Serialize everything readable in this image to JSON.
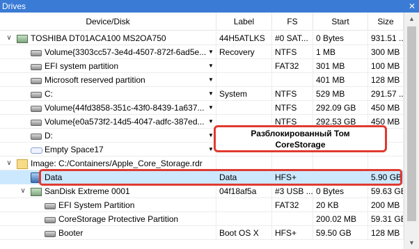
{
  "window": {
    "title": "Drives"
  },
  "columns": [
    "Device/Disk",
    "Label",
    "FS",
    "Start",
    "Size"
  ],
  "rows": [
    {
      "indent": 0,
      "chevron": "∨",
      "icon": "usb-drive-icon",
      "name": "TOSHIBA DT01ACA100 MS2OA750",
      "label": "44H5ATLKS",
      "fs": "#0 SAT...",
      "start": "0 Bytes",
      "size": "931.51 ...",
      "drop": false
    },
    {
      "indent": 1,
      "chevron": "",
      "icon": "hdd-icon",
      "name": "Volume{3303cc57-3e4d-4507-872f-6ad5e...",
      "label": "Recovery",
      "fs": "NTFS",
      "start": "1 MB",
      "size": "300 MB",
      "drop": true
    },
    {
      "indent": 1,
      "chevron": "",
      "icon": "hdd-icon",
      "name": "EFI system partition",
      "label": "",
      "fs": "FAT32",
      "start": "301 MB",
      "size": "100 MB",
      "drop": true
    },
    {
      "indent": 1,
      "chevron": "",
      "icon": "hdd-icon",
      "name": "Microsoft reserved partition",
      "label": "",
      "fs": "",
      "start": "401 MB",
      "size": "128 MB",
      "drop": true
    },
    {
      "indent": 1,
      "chevron": "",
      "icon": "hdd-icon",
      "name": "C:",
      "label": "System",
      "fs": "NTFS",
      "start": "529 MB",
      "size": "291.57 ...",
      "drop": true
    },
    {
      "indent": 1,
      "chevron": "",
      "icon": "hdd-icon",
      "name": "Volume{44fd3858-351c-43f0-8439-1a637...",
      "label": "",
      "fs": "NTFS",
      "start": "292.09 GB",
      "size": "450 MB",
      "drop": true
    },
    {
      "indent": 1,
      "chevron": "",
      "icon": "hdd-icon",
      "name": "Volume{e0a573f2-14d5-4047-adfc-387ed...",
      "label": "",
      "fs": "NTFS",
      "start": "292.53 GB",
      "size": "450 MB",
      "drop": true
    },
    {
      "indent": 1,
      "chevron": "",
      "icon": "hdd-icon",
      "name": "D:",
      "label": "",
      "fs": "",
      "start": "",
      "size": "",
      "drop": true
    },
    {
      "indent": 1,
      "chevron": "",
      "icon": "empty-space-icon",
      "name": "Empty Space17",
      "label": "",
      "fs": "",
      "start": "",
      "size": "B",
      "drop": true
    },
    {
      "indent": 0,
      "chevron": "∨",
      "icon": "image-file-icon",
      "name": "Image: C:/Containers/Apple_Core_Storage.rdr",
      "label": "",
      "fs": "",
      "start": "",
      "size": "",
      "drop": false
    },
    {
      "indent": 1,
      "chevron": "",
      "icon": "corestorage-icon",
      "name": "Data",
      "label": "Data",
      "fs": "HFS+",
      "start": "",
      "size": "5.90 GB",
      "drop": false,
      "selected": true
    },
    {
      "indent": 1,
      "chevron": "∨",
      "icon": "usb-drive-icon",
      "name": "SanDisk Extreme 0001",
      "label": "04f18af5a",
      "fs": "#3 USB ...",
      "start": "0 Bytes",
      "size": "59.63 GB",
      "drop": false
    },
    {
      "indent": 2,
      "chevron": "",
      "icon": "hdd-icon",
      "name": "EFI System Partition",
      "label": "",
      "fs": "FAT32",
      "start": "20 KB",
      "size": "200 MB",
      "drop": false
    },
    {
      "indent": 2,
      "chevron": "",
      "icon": "hdd-icon",
      "name": "CoreStorage Protective Partition",
      "label": "",
      "fs": "",
      "start": "200.02 MB",
      "size": "59.31 GB",
      "drop": false
    },
    {
      "indent": 2,
      "chevron": "",
      "icon": "hdd-icon",
      "name": "Booter",
      "label": "Boot OS X",
      "fs": "HFS+",
      "start": "59.50 GB",
      "size": "128 MB",
      "drop": false
    }
  ],
  "callout": {
    "line1": "Разблокированный Том",
    "line2": "CoreStorage"
  },
  "colors": {
    "title_bar": "#3a7bd5",
    "selected_row": "#cce8ff",
    "annotation_red": "#e03a2f"
  }
}
